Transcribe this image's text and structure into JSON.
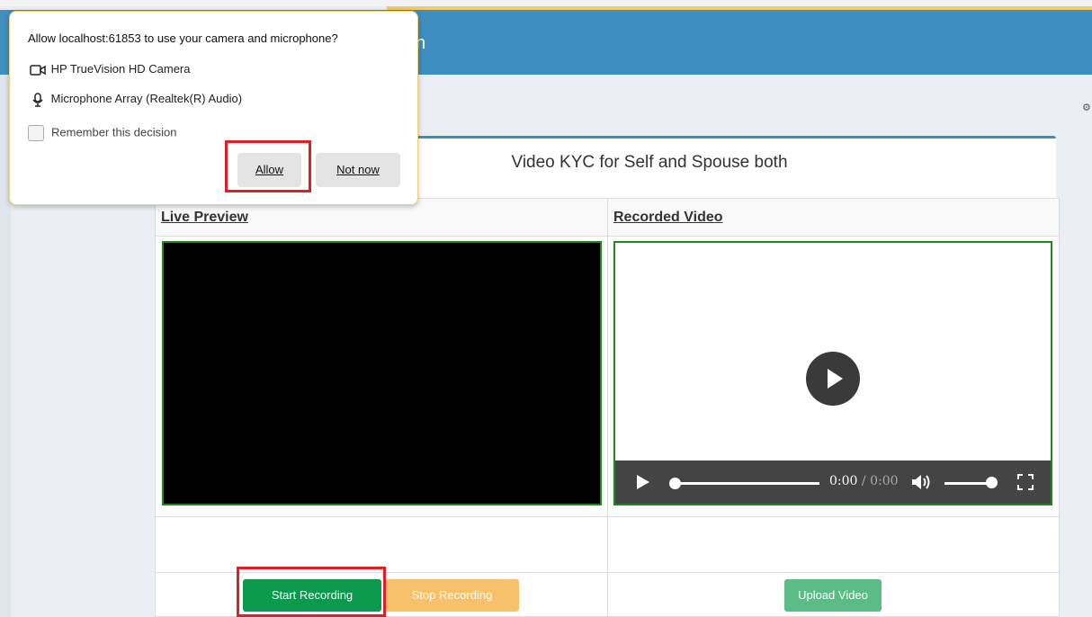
{
  "permission_prompt": {
    "title": "Allow localhost:61853 to use your camera and microphone?",
    "camera_label": "HP TrueVision HD Camera",
    "microphone_label": "Microphone Array (Realtek(R) Audio)",
    "remember_label": "Remember this decision",
    "remember_checked": false,
    "allow_label": "Allow",
    "not_now_label": "Not now"
  },
  "header": {
    "title_fragment": "n"
  },
  "card": {
    "title": "Video KYC for Self and Spouse both",
    "live_preview_heading": "Live Preview",
    "recorded_video_heading": "Recorded Video"
  },
  "player": {
    "current_time": "0:00",
    "separator": " / ",
    "duration": "0:00"
  },
  "buttons": {
    "start_recording": "Start Recording",
    "stop_recording": "Stop Recording",
    "upload_video": "Upload Video"
  },
  "colors": {
    "header_blue": "#3e8ec0",
    "start_green": "#0b9a4d",
    "stop_orange": "#f7c06b",
    "upload_green": "#5cbc86",
    "highlight_red": "#e01e26",
    "video_border": "#1a8a1a"
  }
}
